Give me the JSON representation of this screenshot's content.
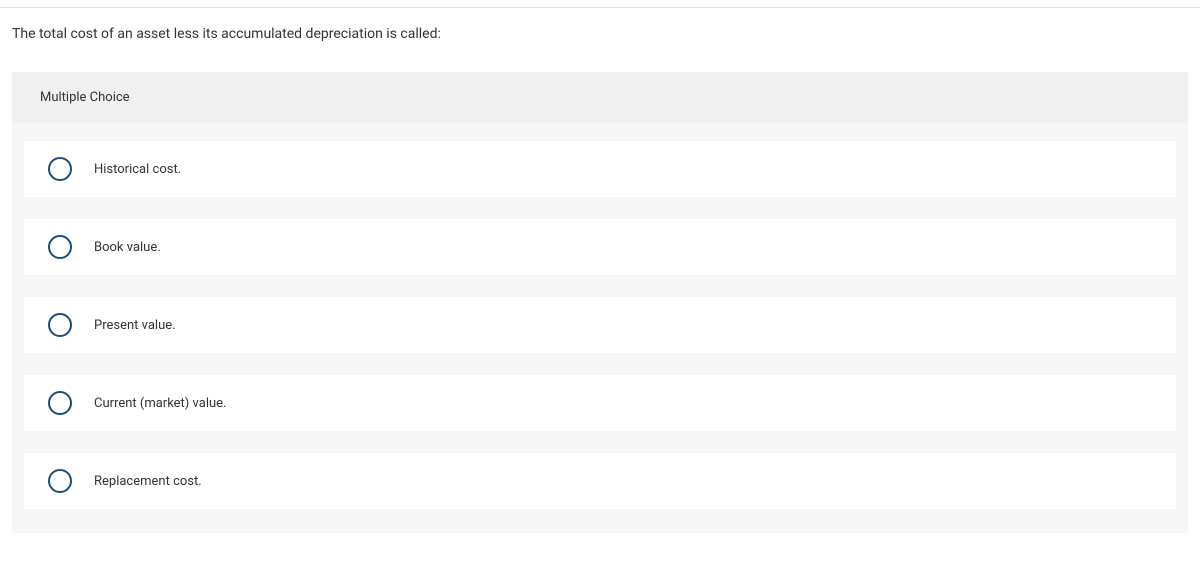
{
  "question": "The total cost of an asset less its accumulated depreciation is called:",
  "section_label": "Multiple Choice",
  "options": [
    {
      "label": "Historical cost."
    },
    {
      "label": "Book value."
    },
    {
      "label": "Present value."
    },
    {
      "label": "Current (market) value."
    },
    {
      "label": "Replacement cost."
    }
  ]
}
